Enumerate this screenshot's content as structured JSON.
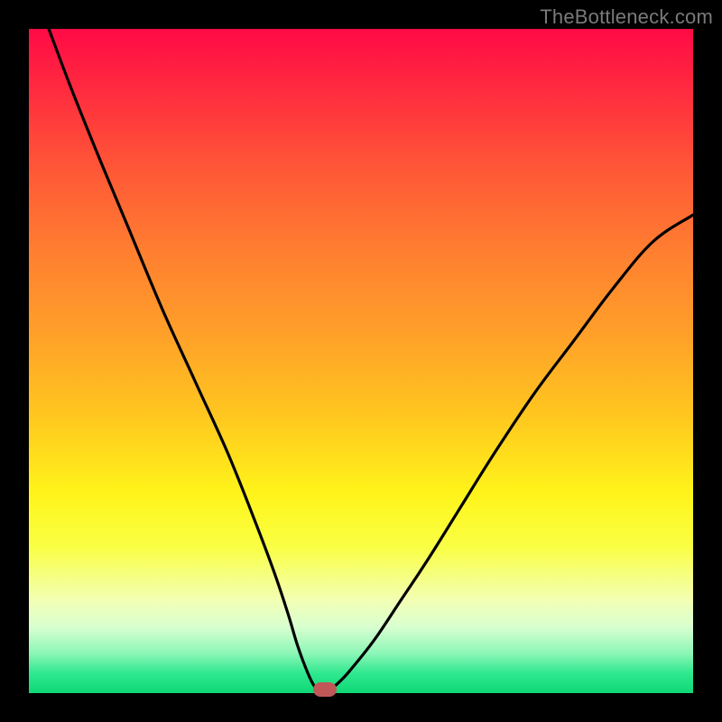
{
  "watermark": "TheBottleneck.com",
  "colors": {
    "frame": "#000000",
    "curve": "#000000",
    "marker": "#c05858",
    "gradient_top": "#ff0a46",
    "gradient_bottom": "#0fd876"
  },
  "chart_data": {
    "type": "line",
    "title": "",
    "xlabel": "",
    "ylabel": "",
    "xlim": [
      0,
      100
    ],
    "ylim": [
      0,
      100
    ],
    "grid": false,
    "legend": false,
    "series": [
      {
        "name": "bottleneck-curve",
        "color": "#000000",
        "x": [
          3,
          6,
          10,
          15,
          20,
          25,
          30,
          34,
          37,
          39,
          40.5,
          42,
          43,
          44,
          45,
          46,
          48,
          52,
          56,
          60,
          65,
          70,
          76,
          82,
          88,
          94,
          100
        ],
        "y": [
          100,
          92,
          82,
          70,
          58,
          47,
          36,
          26,
          18,
          12,
          7,
          3,
          1,
          0,
          0,
          1,
          3,
          8,
          14,
          20,
          28,
          36,
          45,
          53,
          61,
          68,
          72
        ]
      }
    ],
    "annotations": [
      {
        "name": "min-marker",
        "x": 44.5,
        "y": 0.5,
        "shape": "rounded-rect",
        "color": "#c05858"
      }
    ]
  }
}
